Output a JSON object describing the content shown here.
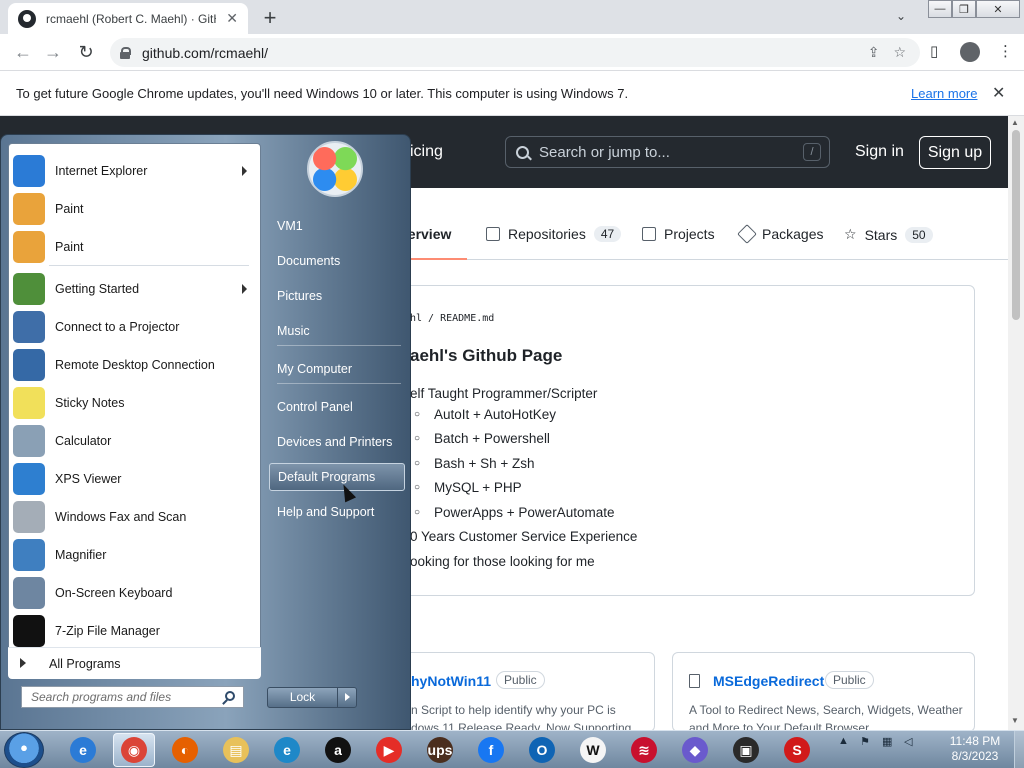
{
  "browser": {
    "tab_title": "rcmaehl (Robert C. Maehl) · GitH",
    "tab_close": "✕",
    "new_tab": "+",
    "tab_list": "⌄",
    "window_buttons": {
      "minimize": "—",
      "restore": "❐",
      "close": "✕"
    },
    "nav": {
      "back": "←",
      "forward": "→",
      "reload": "↻"
    },
    "url": "github.com/rcmaehl/",
    "omnibox_icons": {
      "share": "⇪",
      "bookmark": "☆"
    },
    "toolbar_icons": {
      "sidepanel": "▯",
      "menu": "⋮"
    }
  },
  "infobar": {
    "message": "To get future Google Chrome updates, you'll need Windows 10 or later. This computer is using Windows 7.",
    "learn_more": "Learn more",
    "close": "✕"
  },
  "github": {
    "header_partial": "icing",
    "search_placeholder": "Search or jump to...",
    "search_shortcut": "/",
    "sign_in": "Sign in",
    "sign_up": "Sign up",
    "tabs": [
      {
        "label": "verview"
      },
      {
        "label": "Repositories",
        "count": "47"
      },
      {
        "label": "Projects"
      },
      {
        "label": "Packages"
      },
      {
        "label": "Stars",
        "count": "50"
      }
    ],
    "readme": {
      "path": "hl / README.md",
      "heading": "aehl's Github Page",
      "lines": [
        "elf Taught Programmer/Scripter",
        "AutoIt + AutoHotKey",
        "Batch + Powershell",
        "Bash + Sh + Zsh",
        "MySQL + PHP",
        "PowerApps + PowerAutomate",
        "0 Years Customer Service Experience",
        "ooking for those looking for me"
      ]
    },
    "repos": [
      {
        "name": "hyNotWin11",
        "visibility": "Public",
        "desc": "n Script to help identify why your PC is\ndows 11 Release Ready. Now Supporting"
      },
      {
        "name": "MSEdgeRedirect",
        "visibility": "Public",
        "desc": "A Tool to Redirect News, Search, Widgets, Weather\nand More to Your Default Browser"
      }
    ]
  },
  "start_menu": {
    "programs": [
      {
        "label": "Internet Explorer",
        "submenu": true,
        "icon": "internet-explorer-icon",
        "color": "#2b7bd6"
      },
      {
        "label": "Paint",
        "submenu": false,
        "icon": "paint-icon",
        "color": "#e9a33b"
      },
      {
        "label": "Paint",
        "submenu": false,
        "icon": "paint-icon",
        "color": "#e9a33b"
      },
      {
        "label": "Getting Started",
        "submenu": true,
        "icon": "getting-started-icon",
        "color": "#4f8f3a"
      },
      {
        "label": "Connect to a Projector",
        "submenu": false,
        "icon": "projector-icon",
        "color": "#3f6ea8"
      },
      {
        "label": "Remote Desktop Connection",
        "submenu": false,
        "icon": "remote-desktop-icon",
        "color": "#3569a6"
      },
      {
        "label": "Sticky Notes",
        "submenu": false,
        "icon": "sticky-notes-icon",
        "color": "#f1e05a"
      },
      {
        "label": "Calculator",
        "submenu": false,
        "icon": "calculator-icon",
        "color": "#8aa0b5"
      },
      {
        "label": "XPS Viewer",
        "submenu": false,
        "icon": "xps-viewer-icon",
        "color": "#2e7fd0"
      },
      {
        "label": "Windows Fax and Scan",
        "submenu": false,
        "icon": "fax-scan-icon",
        "color": "#a4adb7"
      },
      {
        "label": "Magnifier",
        "submenu": false,
        "icon": "magnifier-icon",
        "color": "#3f7fc0"
      },
      {
        "label": "On-Screen Keyboard",
        "submenu": false,
        "icon": "keyboard-icon",
        "color": "#6e86a1"
      },
      {
        "label": "7-Zip File Manager",
        "submenu": false,
        "icon": "7zip-icon",
        "color": "#111111"
      }
    ],
    "all_programs": "All Programs",
    "search_placeholder": "Search programs and files",
    "right_links": [
      {
        "label": "VM1"
      },
      {
        "label": "Documents"
      },
      {
        "label": "Pictures"
      },
      {
        "label": "Music"
      },
      {
        "label": "My Computer"
      },
      {
        "label": "Control Panel"
      },
      {
        "label": "Devices and Printers"
      },
      {
        "label": "Default Programs",
        "highlighted": true
      },
      {
        "label": "Help and Support"
      }
    ],
    "lock": "Lock"
  },
  "taskbar": {
    "apps": [
      {
        "name": "internet-explorer",
        "glyph": "e",
        "color": "#2b7bd6"
      },
      {
        "name": "chrome",
        "glyph": "◉",
        "color": "#db4437",
        "active": true
      },
      {
        "name": "firefox",
        "glyph": "◐",
        "color": "#e66000"
      },
      {
        "name": "file-explorer",
        "glyph": "▤",
        "color": "#e8c15a"
      },
      {
        "name": "edge",
        "glyph": "e",
        "color": "#1e88c8"
      },
      {
        "name": "amazon",
        "glyph": "a",
        "color": "#111111"
      },
      {
        "name": "youtube",
        "glyph": "▶",
        "color": "#e52d27"
      },
      {
        "name": "ups",
        "glyph": "ups",
        "color": "#4b2e1e"
      },
      {
        "name": "facebook",
        "glyph": "f",
        "color": "#1877f2"
      },
      {
        "name": "outlook",
        "glyph": "O",
        "color": "#0f64b4"
      },
      {
        "name": "wikipedia",
        "glyph": "W",
        "color": "#f5f5f5"
      },
      {
        "name": "bank-of-america",
        "glyph": "≋",
        "color": "#c8102e"
      },
      {
        "name": "app",
        "glyph": "◆",
        "color": "#6a5acd"
      },
      {
        "name": "store",
        "glyph": "▣",
        "color": "#2a2a2a"
      },
      {
        "name": "s-app",
        "glyph": "S",
        "color": "#d11a1a"
      }
    ],
    "time": "11:48 PM",
    "date": "8/3/2023"
  }
}
